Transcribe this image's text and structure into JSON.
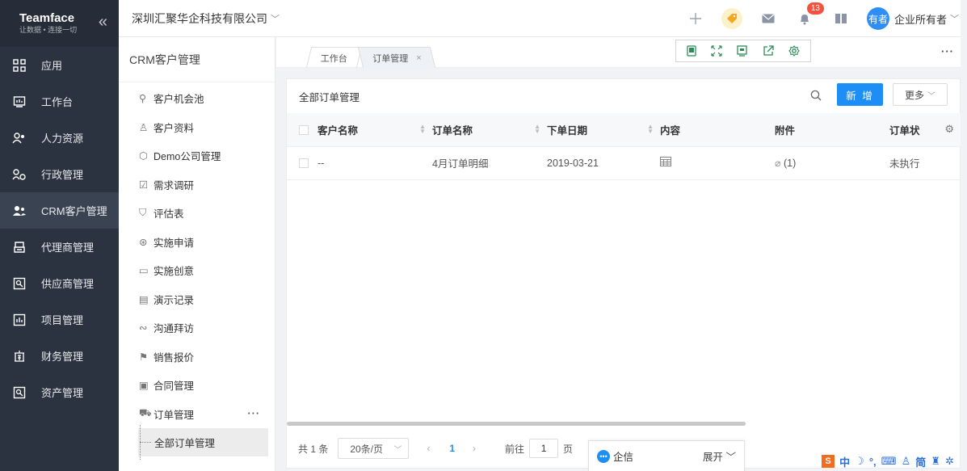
{
  "brand": {
    "name": "Teamface",
    "tagline": "让数据 • 连接一切",
    "collapse_glyph": "«"
  },
  "leftnav": [
    {
      "label": "应用",
      "icon": "apps-icon"
    },
    {
      "label": "工作台",
      "icon": "workbench-icon"
    },
    {
      "label": "人力资源",
      "icon": "hr-icon"
    },
    {
      "label": "行政管理",
      "icon": "admin-icon"
    },
    {
      "label": "CRM客户管理",
      "icon": "crm-icon",
      "active": true
    },
    {
      "label": "代理商管理",
      "icon": "agent-icon"
    },
    {
      "label": "供应商管理",
      "icon": "supplier-icon"
    },
    {
      "label": "项目管理",
      "icon": "project-icon"
    },
    {
      "label": "财务管理",
      "icon": "finance-icon"
    },
    {
      "label": "资产管理",
      "icon": "asset-icon"
    }
  ],
  "topbar": {
    "company": "深圳汇聚华企科技有限公司",
    "notification_count": "13",
    "user_avatar_text": "有者",
    "user_name": "企业所有者"
  },
  "subside": {
    "title": "CRM客户管理",
    "items": [
      {
        "label": "客户机会池",
        "icon": "funnel-icon"
      },
      {
        "label": "客户资料",
        "icon": "contacts-icon"
      },
      {
        "label": "Demo公司管理",
        "icon": "cube-icon"
      },
      {
        "label": "需求调研",
        "icon": "survey-icon"
      },
      {
        "label": "评估表",
        "icon": "shield-icon"
      },
      {
        "label": "实施申请",
        "icon": "seal-icon"
      },
      {
        "label": "实施创意",
        "icon": "book-icon"
      },
      {
        "label": "演示记录",
        "icon": "clipboard-icon"
      },
      {
        "label": "沟通拜访",
        "icon": "chat-icon"
      },
      {
        "label": "销售报价",
        "icon": "price-icon"
      },
      {
        "label": "合同管理",
        "icon": "contract-icon"
      },
      {
        "label": "订单管理",
        "icon": "cart-icon",
        "more": "···"
      }
    ],
    "child": "全部订单管理"
  },
  "tabs": [
    {
      "label": "工作台"
    },
    {
      "label": "订单管理",
      "close": "×"
    }
  ],
  "tabmore": "···",
  "panel": {
    "title": "全部订单管理",
    "new_label": "新 增",
    "more_label": "更多",
    "columns": [
      "客户名称",
      "订单名称",
      "下单日期",
      "内容",
      "附件",
      "订单状"
    ],
    "rows": [
      {
        "customer": "--",
        "order": "4月订单明细",
        "date": "2019-03-21",
        "attachment": "(1)",
        "status": "未执行"
      }
    ]
  },
  "pager": {
    "total": "共 1 条",
    "page_size": "20条/页",
    "current": "1",
    "goto_label": "前往",
    "goto_value": "1",
    "page_label": "页"
  },
  "chat": {
    "label": "企信",
    "expand": "展开"
  },
  "ime": {
    "items": [
      "中",
      "简"
    ]
  },
  "colors": {
    "accent": "#1e8ef7",
    "nav_bg": "#2b3340",
    "badge": "#f5513f"
  }
}
